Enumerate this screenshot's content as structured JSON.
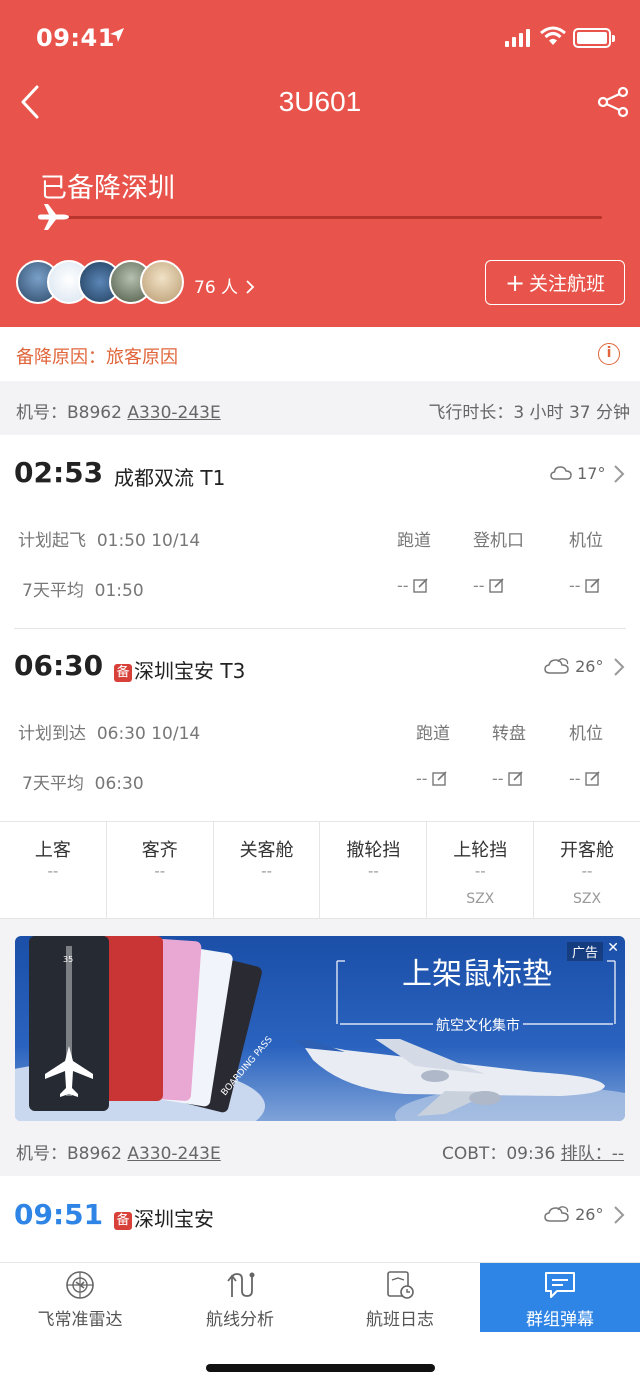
{
  "status_bar": {
    "time": "09:41"
  },
  "header": {
    "title": "3U601",
    "status": "已备降深圳",
    "follower_count": "76 人",
    "follow_button": "关注航班",
    "progress": 0.0
  },
  "divert": {
    "reason": "备降原因：旅客原因"
  },
  "aircraft_row": {
    "reg_label": "机号：B8962 ",
    "model": "A330-243E",
    "duration": "飞行时长：3 小时 37 分钟"
  },
  "departure": {
    "time": "02:53",
    "airport": "成都双流 T1",
    "temp": "17°",
    "plan_label": "计划起飞",
    "plan_value": "01:50 10/14",
    "avg_label": "7天平均",
    "avg_value": "01:50",
    "cols": [
      "跑道",
      "登机口",
      "机位"
    ],
    "vals": [
      "--",
      "--",
      "--"
    ]
  },
  "arrival": {
    "time": "06:30",
    "tag": "备",
    "airport": "深圳宝安 T3",
    "temp": "26°",
    "plan_label": "计划到达",
    "plan_value": "06:30 10/14",
    "avg_label": "7天平均",
    "avg_value": "06:30",
    "cols": [
      "跑道",
      "转盘",
      "机位"
    ],
    "vals": [
      "--",
      "--",
      "--"
    ]
  },
  "milestones": [
    {
      "title": "上客",
      "value": "--",
      "sub": ""
    },
    {
      "title": "客齐",
      "value": "--",
      "sub": ""
    },
    {
      "title": "关客舱",
      "value": "--",
      "sub": ""
    },
    {
      "title": "撤轮挡",
      "value": "--",
      "sub": ""
    },
    {
      "title": "上轮挡",
      "value": "--",
      "sub": "SZX"
    },
    {
      "title": "开客舱",
      "value": "--",
      "sub": "SZX"
    }
  ],
  "ad": {
    "tag": "广告",
    "close": "✕",
    "headline": "上架鼠标垫",
    "subline": "航空文化集市",
    "card_text": "BOARDING PASS",
    "runway_num": "35"
  },
  "aircraft_row2": {
    "reg_label": "机号：B8962 ",
    "model": "A330-243E",
    "cobt": "COBT：09:36 ",
    "queue": "排队：--"
  },
  "next_leg": {
    "time": "09:51",
    "tag": "备",
    "airport": "深圳宝安",
    "temp": "26°"
  },
  "tabs": [
    {
      "label": "飞常准雷达",
      "icon": "radar-icon",
      "active": false
    },
    {
      "label": "航线分析",
      "icon": "route-icon",
      "active": false
    },
    {
      "label": "航班日志",
      "icon": "log-icon",
      "active": false
    },
    {
      "label": "群组弹幕",
      "icon": "chat-icon",
      "active": true
    }
  ],
  "colors": {
    "header": "#e8544b",
    "accent_blue": "#2f85e6",
    "reason": "#e0653a",
    "divert_tag": "#d8413a"
  }
}
